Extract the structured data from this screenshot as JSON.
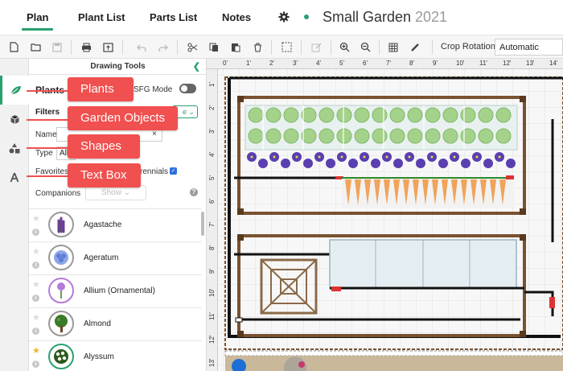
{
  "nav": {
    "tabs": [
      {
        "label": "Plan"
      },
      {
        "label": "Plant List"
      },
      {
        "label": "Parts List"
      },
      {
        "label": "Notes"
      }
    ],
    "active_tab": "Plan",
    "garden_name": "Small Garden",
    "year": "2021"
  },
  "toolbar": {
    "icons": [
      "new-file-icon",
      "open-folder-icon",
      "save-icon",
      "print-icon",
      "export-icon",
      "undo-icon",
      "redo-icon",
      "cut-icon",
      "copy-icon",
      "paste-icon",
      "delete-icon",
      "select-icon",
      "edit-icon",
      "zoom-in-icon",
      "zoom-out-icon",
      "grid-icon",
      "measure-icon"
    ],
    "crop_rotation_label": "Crop Rotation",
    "crop_rotation_value": "Automatic"
  },
  "panel": {
    "header": "Drawing Tools",
    "section_title": "Plants",
    "sfg_mode_label": "SFG Mode",
    "sfg_mode_on": false,
    "filters_label": "Filters",
    "more_label": "e",
    "name_label": "Name",
    "name_value": "",
    "clear_label": "×",
    "type_label": "Type",
    "type_value": "All",
    "favorites_label": "Favorites",
    "perennials_label": "rennials",
    "perennials_checked": true,
    "companions_label": "Companions",
    "show_label": "Show",
    "help_label": "?"
  },
  "plants": [
    {
      "name": "Agastache",
      "favorite": false,
      "color": "#7a4fa3"
    },
    {
      "name": "Ageratum",
      "favorite": false,
      "color": "#6a8ad8"
    },
    {
      "name": "Allium (Ornamental)",
      "favorite": false,
      "color": "#b47ad8"
    },
    {
      "name": "Almond",
      "favorite": false,
      "color": "#3b7a2a"
    },
    {
      "name": "Alyssum",
      "favorite": true,
      "color": "#ffffff"
    }
  ],
  "callouts": [
    {
      "label": "Plants"
    },
    {
      "label": "Garden Objects"
    },
    {
      "label": "Shapes"
    },
    {
      "label": "Text Box"
    }
  ],
  "ruler": {
    "x_labels": [
      "0'",
      "1'",
      "2'",
      "3'",
      "4'",
      "5'",
      "6'",
      "7'",
      "8'",
      "9'",
      "10'",
      "11'",
      "12'",
      "13'",
      "14'"
    ],
    "y_labels": [
      "1'",
      "2'",
      "3'",
      "4'",
      "5'",
      "6'",
      "7'",
      "8'",
      "9'",
      "10'",
      "11'",
      "12'",
      "13'"
    ]
  },
  "colors": {
    "accent": "#2aa06e",
    "callout": "#f0504f",
    "wood": "#7a5230",
    "pipe": "#111111"
  }
}
